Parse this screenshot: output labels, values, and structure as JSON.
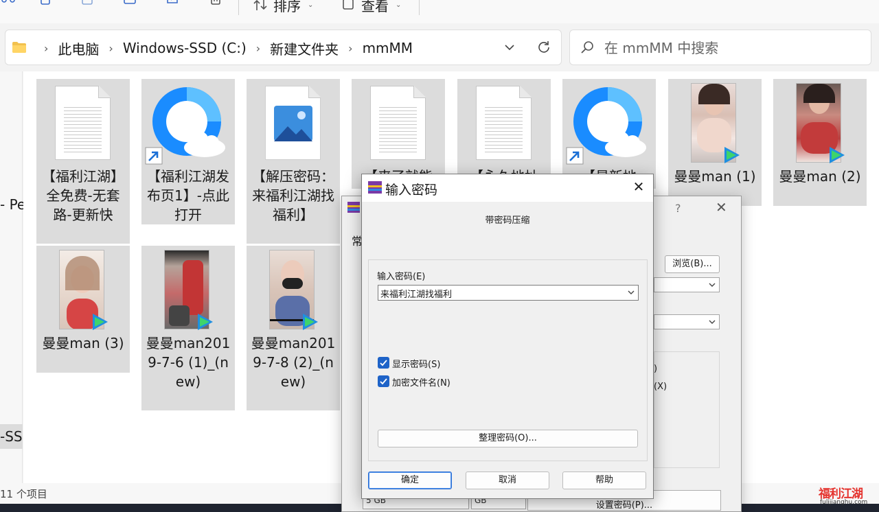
{
  "toolbar": {
    "sort_label": "排序",
    "view_label": "查看",
    "more_label": "···"
  },
  "address": {
    "crumbs": [
      "此电脑",
      "Windows-SSD (C:)",
      "新建文件夹",
      "mmMM"
    ],
    "search_placeholder": "在 mmMM 中搜索"
  },
  "nav": {
    "item_a": "- Pe",
    "item_b": "-SS"
  },
  "files": [
    {
      "name": "【福利江湖】全免费-无套路-更新快",
      "type": "document"
    },
    {
      "name": "【福利江湖发布页1】-点此打开",
      "type": "browser-shortcut"
    },
    {
      "name": "【解压密码：来福利江湖找福利】",
      "type": "image"
    },
    {
      "name": "【来了就能",
      "type": "document"
    },
    {
      "name": "【永久地址",
      "type": "document"
    },
    {
      "name": "【最新地",
      "type": "browser-shortcut"
    },
    {
      "name": "曼曼man (1)",
      "type": "video"
    },
    {
      "name": "曼曼man (2)",
      "type": "video"
    },
    {
      "name": "曼曼man (3)",
      "type": "video"
    },
    {
      "name": "曼曼man2019-7-6 (1)_(new)",
      "type": "video"
    },
    {
      "name": "曼曼man2019-7-8 (2)_(new)",
      "type": "video"
    }
  ],
  "status": {
    "item_count": "11 个项目"
  },
  "back_dialog": {
    "title_help": "?",
    "close": "✕",
    "tab_fragment": "常",
    "browse_button": "浏览(B)...",
    "option_fragment_1": ")",
    "option_fragment_2": "(X)",
    "size_fragment": "5 GB",
    "unit_fragment": "GB",
    "set_password_button": "设置密码(P)..."
  },
  "front_dialog": {
    "title": "输入密码",
    "close": "✕",
    "subtitle": "带密码压缩",
    "password_label": "输入密码(E)",
    "password_value": "来福利江湖找福利",
    "show_password_label": "显示密码(S)",
    "show_password_checked": true,
    "encrypt_names_label": "加密文件名(N)",
    "encrypt_names_checked": true,
    "organize_button": "整理密码(O)...",
    "ok_button": "确定",
    "cancel_button": "取消",
    "help_button": "帮助"
  },
  "watermark": {
    "text": "福利江湖",
    "url": "fulijianghu.com"
  },
  "colors": {
    "accent": "#1e63c8",
    "tile_bg": "#dcdcdc",
    "browser_blue": "#1a8cff"
  }
}
